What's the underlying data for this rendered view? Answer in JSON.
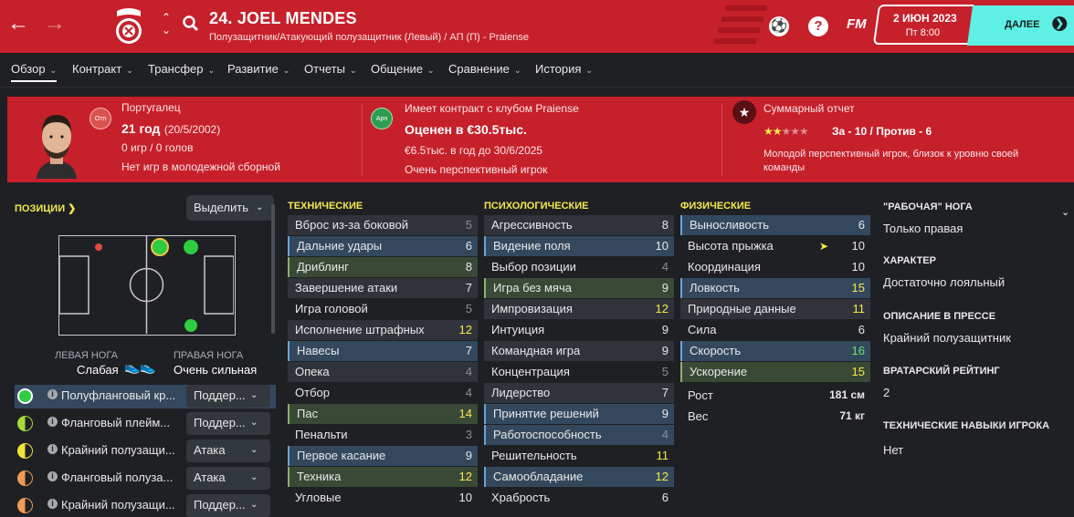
{
  "header": {
    "player_name": "24. JOEL MENDES",
    "player_role": "Полузащитник/Атакующий полузащитник (Левый) / АП (П) - Praiense",
    "fm_label": "FM",
    "date": "2 ИЮН 2023",
    "day_time": "Пт 8:00",
    "next_label": "ДАЛЕЕ",
    "back_icon": "arrow-left-icon",
    "forward_icon": "arrow-right-icon"
  },
  "tabs": [
    {
      "label": "Обзор"
    },
    {
      "label": "Контракт"
    },
    {
      "label": "Трансфер"
    },
    {
      "label": "Развитие"
    },
    {
      "label": "Отчеты"
    },
    {
      "label": "Общение"
    },
    {
      "label": "Сравнение"
    },
    {
      "label": "История"
    }
  ],
  "info": {
    "nationality": "Португалец",
    "age": "21 год",
    "dob": "(20/5/2002)",
    "games": "0 игр / 0 голов",
    "youth": "Нет игр в молодежной сборной",
    "badge1": "Отп",
    "contract_title": "Имеет контракт с клубом Praiense",
    "badge2": "Арн",
    "valued": "Оценен в €30.5тыс.",
    "wage": "€6.5тыс. в год до 30/6/2025",
    "prospect": "Очень перспективный игрок",
    "summary_title": "Суммарный отчет",
    "star_rating": 2,
    "star_max": 5,
    "for_against": "За - 10 / Против - 6",
    "summary_text1": "Молодой перспективный игрок, близок к уровню своей",
    "summary_text2": "команды"
  },
  "positions": {
    "title": "ПОЗИЦИИ",
    "select_label": "Выделить",
    "left_foot_label": "ЛЕВАЯ НОГА",
    "left_foot_value": "Слабая",
    "right_foot_label": "ПРАВАЯ НОГА",
    "right_foot_value": "Очень сильная",
    "rows": [
      {
        "label": "Полуфланговый кр...",
        "role": "Поддер...",
        "color": "#2ecc40"
      },
      {
        "label": "Фланговый плейм...",
        "role": "Поддер...",
        "color": "#a8d83a"
      },
      {
        "label": "Крайний полузащи...",
        "role": "Атака",
        "color": "#f2e13a"
      },
      {
        "label": "Фланговый полуза...",
        "role": "Атака",
        "color": "#f09a55"
      },
      {
        "label": "Крайний полузащи...",
        "role": "Поддер...",
        "color": "#f09a55"
      }
    ]
  },
  "technical": {
    "title": "ТЕХНИЧЕСКИЕ",
    "attrs": [
      {
        "name": "Вброс из-за боковой",
        "value": "5"
      },
      {
        "name": "Дальние удары",
        "value": "6"
      },
      {
        "name": "Дриблинг",
        "value": "8"
      },
      {
        "name": "Завершение атаки",
        "value": "7"
      },
      {
        "name": "Игра головой",
        "value": "5"
      },
      {
        "name": "Исполнение штрафных",
        "value": "12"
      },
      {
        "name": "Навесы",
        "value": "7"
      },
      {
        "name": "Опека",
        "value": "4"
      },
      {
        "name": "Отбор",
        "value": "4"
      },
      {
        "name": "Пас",
        "value": "14"
      },
      {
        "name": "Пенальти",
        "value": "3"
      },
      {
        "name": "Первое касание",
        "value": "9"
      },
      {
        "name": "Техника",
        "value": "12"
      },
      {
        "name": "Угловые",
        "value": "10"
      }
    ]
  },
  "mental": {
    "title": "ПСИХОЛОГИЧЕСКИЕ",
    "attrs": [
      {
        "name": "Агрессивность",
        "value": "8"
      },
      {
        "name": "Видение поля",
        "value": "10"
      },
      {
        "name": "Выбор позиции",
        "value": "4"
      },
      {
        "name": "Игра без мяча",
        "value": "9"
      },
      {
        "name": "Импровизация",
        "value": "12"
      },
      {
        "name": "Интуиция",
        "value": "9"
      },
      {
        "name": "Командная игра",
        "value": "9"
      },
      {
        "name": "Концентрация",
        "value": "5"
      },
      {
        "name": "Лидерство",
        "value": "7"
      },
      {
        "name": "Принятие решений",
        "value": "9"
      },
      {
        "name": "Работоспособность",
        "value": "4"
      },
      {
        "name": "Решительность",
        "value": "11"
      },
      {
        "name": "Самообладание",
        "value": "12"
      },
      {
        "name": "Храбрость",
        "value": "6"
      }
    ]
  },
  "physical": {
    "title": "ФИЗИЧЕСКИЕ",
    "attrs": [
      {
        "name": "Выносливость",
        "value": "6"
      },
      {
        "name": "Высота прыжка",
        "value": "10"
      },
      {
        "name": "Координация",
        "value": "10"
      },
      {
        "name": "Ловкость",
        "value": "15"
      },
      {
        "name": "Природные данные",
        "value": "11"
      },
      {
        "name": "Сила",
        "value": "6"
      },
      {
        "name": "Скорость",
        "value": "16"
      },
      {
        "name": "Ускорение",
        "value": "15"
      }
    ],
    "height_label": "Рост",
    "height_value": "181 см",
    "weight_label": "Вес",
    "weight_value": "71 кг"
  },
  "right": {
    "foot_h": "\"РАБОЧАЯ\" НОГА",
    "foot_v": "Только правая",
    "char_h": "ХАРАКТЕР",
    "char_v": "Достаточно лояльный",
    "press_h": "ОПИСАНИЕ В ПРЕССЕ",
    "press_v": "Крайний полузащитник",
    "gk_h": "ВРАТАРСКИЙ РЕЙТИНГ",
    "gk_v": "2",
    "tech_h": "ТЕХНИЧЕСКИЕ НАВЫКИ ИГРОКА",
    "tech_v": "Нет"
  }
}
